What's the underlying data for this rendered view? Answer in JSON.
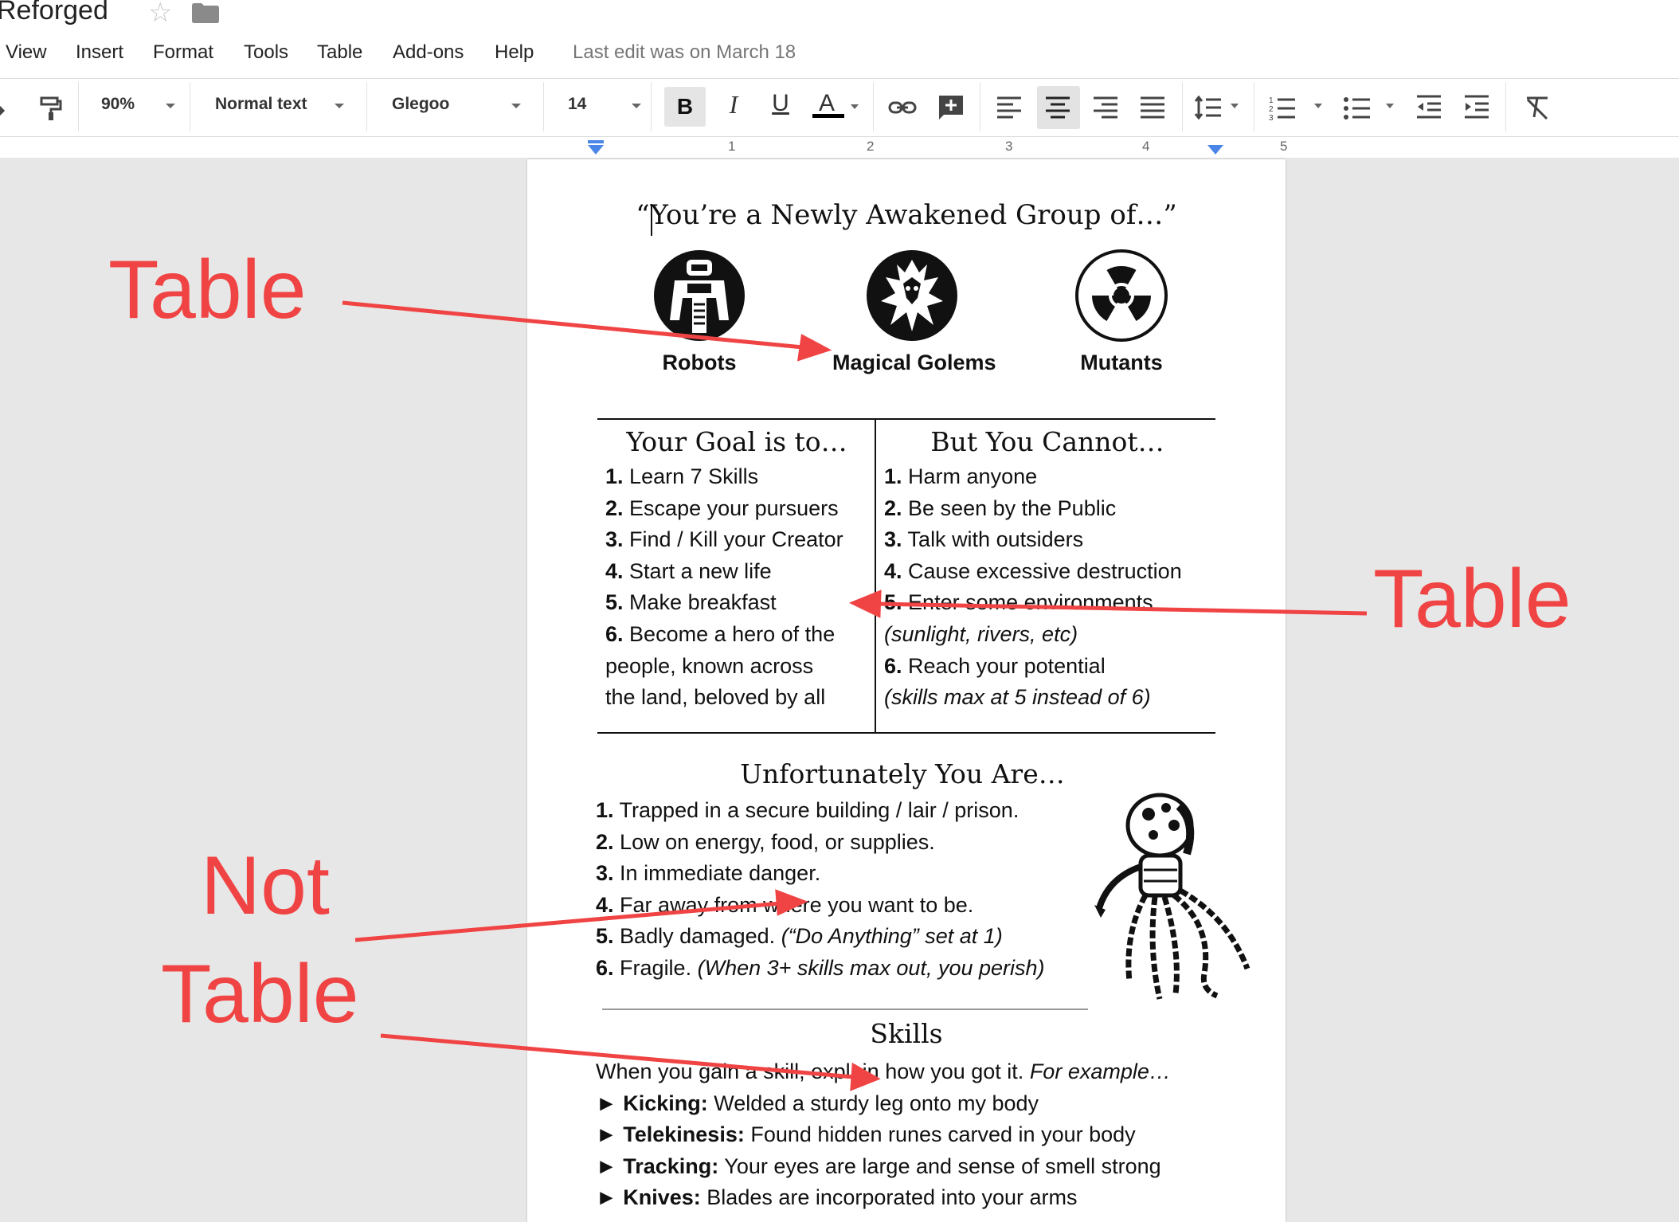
{
  "doc": {
    "title": "Reforged"
  },
  "menu": {
    "items": [
      "View",
      "Insert",
      "Format",
      "Tools",
      "Table",
      "Add-ons",
      "Help"
    ],
    "last_edit": "Last edit was on March 18"
  },
  "toolbar": {
    "zoom": "90%",
    "style": "Normal text",
    "font": "Glegoo",
    "size": "14",
    "bold": "B",
    "italic": "I",
    "underline": "U",
    "text_color": "A"
  },
  "ruler": {
    "numbers": [
      "1",
      "2",
      "3",
      "4",
      "5"
    ]
  },
  "page": {
    "heading": "“You’re a Newly Awakened Group of…”",
    "groups": [
      "Robots",
      "Magical Golems",
      "Mutants"
    ],
    "goals": {
      "head": "Your Goal is to…",
      "items": [
        {
          "n": "1.",
          "t": "Learn 7 Skills"
        },
        {
          "n": "2.",
          "t": "Escape your pursuers"
        },
        {
          "n": "3.",
          "t": "Find / Kill your Creator"
        },
        {
          "n": "4.",
          "t": "Start a new life"
        },
        {
          "n": "5.",
          "t": "Make breakfast"
        },
        {
          "n": "6.",
          "t": "Become a hero of the"
        },
        {
          "n": "",
          "t": "people, known across"
        },
        {
          "n": "",
          "t": "the land, beloved by all"
        }
      ]
    },
    "cannot": {
      "head": "But You Cannot…",
      "items": [
        {
          "n": "1.",
          "t": "Harm anyone"
        },
        {
          "n": "2.",
          "t": "Be seen by the Public"
        },
        {
          "n": "3.",
          "t": "Talk with outsiders"
        },
        {
          "n": "4.",
          "t": "Cause excessive destruction"
        },
        {
          "n": "5.",
          "t": "Enter some environments"
        },
        {
          "n": "",
          "t": "(sunlight, rivers, etc)"
        },
        {
          "n": "6.",
          "t": "Reach your potential"
        },
        {
          "n": "",
          "t": "(skills max at 5 instead of 6)"
        }
      ]
    },
    "unfortunately": {
      "head": "Unfortunately You Are…",
      "items": [
        {
          "n": "1.",
          "t": "Trapped in a secure building / lair / prison.",
          "i": ""
        },
        {
          "n": "2.",
          "t": "Low on energy, food, or supplies.",
          "i": ""
        },
        {
          "n": "3.",
          "t": "In immediate danger.",
          "i": ""
        },
        {
          "n": "4.",
          "t": "Far away from where you want to be.",
          "i": ""
        },
        {
          "n": "5.",
          "t": "Badly damaged. ",
          "i": "(“Do Anything” set at 1)"
        },
        {
          "n": "6.",
          "t": "Fragile. ",
          "i": "(When 3+ skills max out, you perish)"
        }
      ]
    },
    "skills": {
      "head": "Skills",
      "intro": "When you gain a skill, explain how you got it. ",
      "intro_italic": "For example…",
      "items": [
        {
          "k": "Kicking:",
          "t": " Welded a sturdy leg onto my body"
        },
        {
          "k": "Telekinesis:",
          "t": " Found hidden runes carved in your body"
        },
        {
          "k": "Tracking:",
          "t": " Your eyes are large and sense of smell strong"
        },
        {
          "k": "Knives:",
          "t": " Blades are incorporated into your arms"
        }
      ]
    }
  },
  "annotations": {
    "table_1": "Table",
    "table_2": "Table",
    "not_line1": "Not",
    "not_line2": "Table"
  },
  "colors": {
    "annotation": "#f04444",
    "ruler_marker": "#4a86e8"
  }
}
